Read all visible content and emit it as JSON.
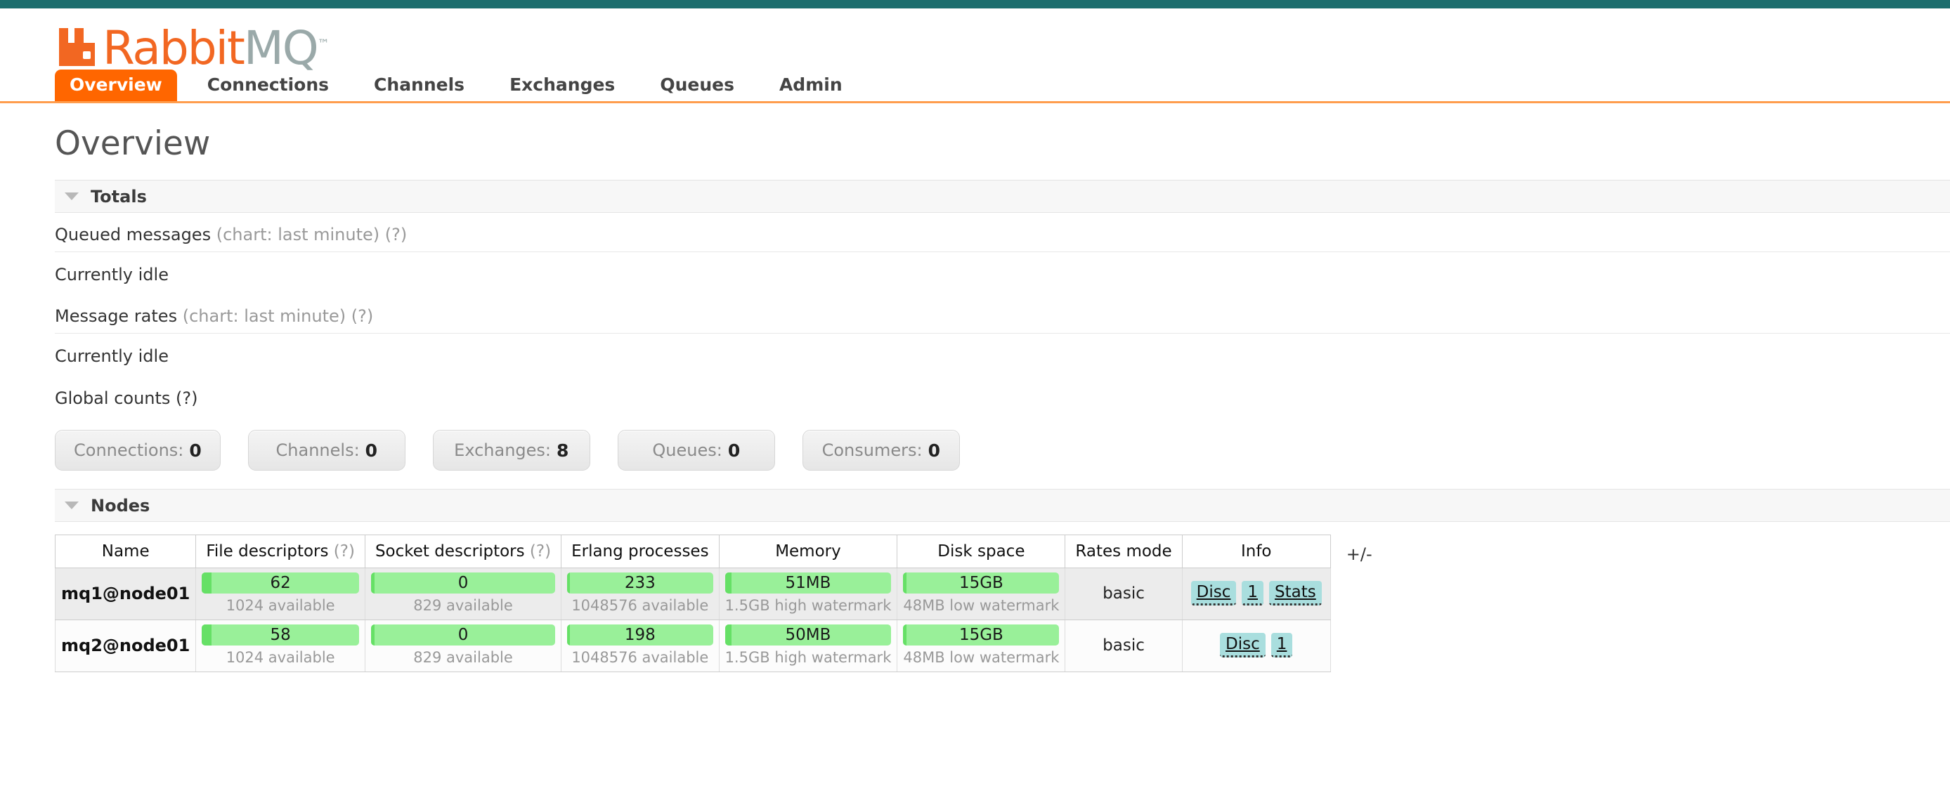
{
  "theme": {
    "topbar_color": "#1d6e6e",
    "accent_orange": "#ff6600",
    "logo_orange": "#f26722",
    "logo_gray": "#9aa9a9",
    "gauge_base": "#99f099",
    "gauge_fill": "#66e066",
    "badge_bg": "#a9dede"
  },
  "logo": {
    "rabbit": "Rabbit",
    "mq": "MQ",
    "tm": "™"
  },
  "nav": {
    "items": [
      {
        "label": "Overview",
        "active": true
      },
      {
        "label": "Connections",
        "active": false
      },
      {
        "label": "Channels",
        "active": false
      },
      {
        "label": "Exchanges",
        "active": false
      },
      {
        "label": "Queues",
        "active": false
      },
      {
        "label": "Admin",
        "active": false
      }
    ]
  },
  "page": {
    "title": "Overview"
  },
  "totals": {
    "section_title": "Totals",
    "queued_messages": {
      "label": "Queued messages",
      "note": "(chart: last minute)",
      "help": "(?)",
      "status": "Currently idle"
    },
    "message_rates": {
      "label": "Message rates",
      "note": "(chart: last minute)",
      "help": "(?)",
      "status": "Currently idle"
    },
    "global_counts": {
      "label": "Global counts",
      "help": "(?)",
      "boxes": [
        {
          "label": "Connections:",
          "value": "0"
        },
        {
          "label": "Channels:",
          "value": "0"
        },
        {
          "label": "Exchanges:",
          "value": "8"
        },
        {
          "label": "Queues:",
          "value": "0"
        },
        {
          "label": "Consumers:",
          "value": "0"
        }
      ]
    }
  },
  "nodes": {
    "section_title": "Nodes",
    "toggle_columns": "+/-",
    "columns": [
      {
        "label": "Name",
        "help": ""
      },
      {
        "label": "File descriptors",
        "help": "(?)"
      },
      {
        "label": "Socket descriptors",
        "help": "(?)"
      },
      {
        "label": "Erlang processes",
        "help": ""
      },
      {
        "label": "Memory",
        "help": ""
      },
      {
        "label": "Disk space",
        "help": ""
      },
      {
        "label": "Rates mode",
        "help": ""
      },
      {
        "label": "Info",
        "help": ""
      }
    ],
    "rows": [
      {
        "name": "mq1@node01",
        "file_descriptors": {
          "value": "62",
          "sub": "1024 available",
          "pct": 6
        },
        "socket_descriptors": {
          "value": "0",
          "sub": "829 available",
          "pct": 2
        },
        "erlang_processes": {
          "value": "233",
          "sub": "1048576 available",
          "pct": 2
        },
        "memory": {
          "value": "51MB",
          "sub": "1.5GB high watermark",
          "pct": 4
        },
        "disk_space": {
          "value": "15GB",
          "sub": "48MB low watermark",
          "pct": 2
        },
        "rates_mode": "basic",
        "info": [
          "Disc",
          "1",
          "Stats"
        ]
      },
      {
        "name": "mq2@node01",
        "file_descriptors": {
          "value": "58",
          "sub": "1024 available",
          "pct": 6
        },
        "socket_descriptors": {
          "value": "0",
          "sub": "829 available",
          "pct": 2
        },
        "erlang_processes": {
          "value": "198",
          "sub": "1048576 available",
          "pct": 2
        },
        "memory": {
          "value": "50MB",
          "sub": "1.5GB high watermark",
          "pct": 4
        },
        "disk_space": {
          "value": "15GB",
          "sub": "48MB low watermark",
          "pct": 2
        },
        "rates_mode": "basic",
        "info": [
          "Disc",
          "1"
        ]
      }
    ]
  }
}
